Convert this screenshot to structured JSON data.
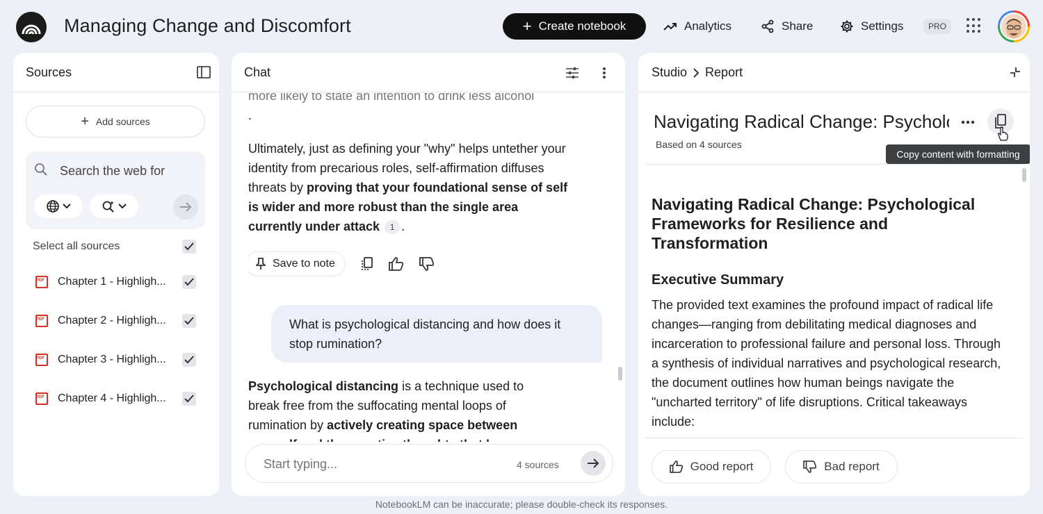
{
  "header": {
    "title": "Managing Change and Discomfort",
    "create_label": "Create notebook",
    "analytics_label": "Analytics",
    "share_label": "Share",
    "settings_label": "Settings",
    "pro_badge": "PRO"
  },
  "sources": {
    "title": "Sources",
    "add_label": "Add sources",
    "search_placeholder": "Search the web for",
    "select_all_label": "Select all sources",
    "items": [
      {
        "label": "Chapter 1 - Highligh..."
      },
      {
        "label": "Chapter 2 - Highligh..."
      },
      {
        "label": "Chapter 3 - Highligh..."
      },
      {
        "label": "Chapter 4 - Highligh..."
      }
    ]
  },
  "chat": {
    "title": "Chat",
    "partial_top": "more likely to state an intention to drink less alcohol",
    "dot": ".",
    "para_start": "Ultimately, just as defining your \"why\" helps untether your identity from precarious roles, self-affirmation diffuses threats by ",
    "para_bold": "proving that your foundational sense of self is wider and more robust than the single area currently under attack",
    "cite": "1",
    "para_end": ".",
    "save_note_label": "Save to note",
    "user_question": "What is psychological distancing and how does it stop rumination?",
    "answer_bold1": "Psychological distancing",
    "answer_mid": " is a technique used to break free from the suffocating mental loops of rumination by ",
    "answer_bold2": "actively creating space between yourself and the negative thoughts that have",
    "input_placeholder": "Start typing...",
    "source_count": "4 sources"
  },
  "studio": {
    "crumb_studio": "Studio",
    "crumb_report": "Report",
    "report_title": "Navigating Radical Change: Psychological Frameworks for Resilience and Transformation",
    "based_on": "Based on 4 sources",
    "tooltip": "Copy content with formatting",
    "h1": "Navigating Radical Change: Psychological Frameworks for Resilience and Transformation",
    "h2": "Executive Summary",
    "summary": "The provided text examines the profound impact of radical life changes—ranging from debilitating medical diagnoses and incarceration to professional failure and personal loss. Through a synthesis of individual narratives and psychological research, the document outlines how human beings navigate the \"uncharted territory\" of life disruptions. Critical takeaways include:",
    "good_label": "Good report",
    "bad_label": "Bad report"
  },
  "footer": "NotebookLM can be inaccurate; please double-check its responses."
}
